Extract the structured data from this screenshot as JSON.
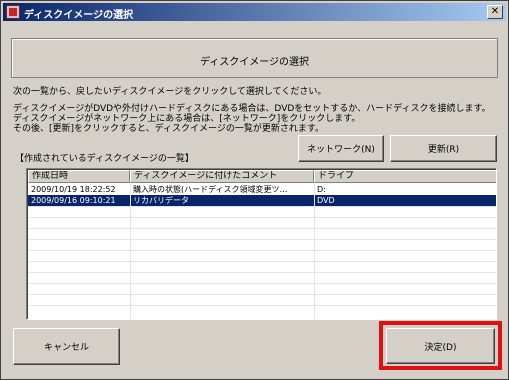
{
  "window": {
    "title": "ディスクイメージの選択",
    "close_symbol": "✕"
  },
  "header": {
    "title": "ディスクイメージの選択"
  },
  "instructions": {
    "line1": "次の一覧から、戻したいディスクイメージをクリックして選択してください。",
    "line2": "ディスクイメージがDVDや外付けハードディスクにある場合は、DVDをセットするか、ハードディスクを接続します。",
    "line3": "ディスクイメージがネットワーク上にある場合は、[ネットワーク]をクリックします。",
    "line4": "その後、[更新]をクリックすると、ディスクイメージの一覧が更新されます。"
  },
  "list_section": {
    "label": "【作成されているディスクイメージの一覧】",
    "network_button": "ネットワーク(N)",
    "refresh_button": "更新(R)"
  },
  "table": {
    "columns": [
      "作成日時",
      "ディスクイメージに付けたコメント",
      "ドライブ"
    ],
    "rows": [
      {
        "date": "2009/10/19 18:22:52",
        "comment": "購入時の状態(ハードディスク領域変更ツ…",
        "drive": "D:",
        "selected": false
      },
      {
        "date": "2009/09/16 09:10:21",
        "comment": "リカバリデータ",
        "drive": "DVD",
        "selected": true
      }
    ]
  },
  "footer": {
    "cancel_button": "キャンセル",
    "ok_button": "決定(D)"
  },
  "colors": {
    "highlight": "#e01010",
    "selection": "#0a246a",
    "titlebar_start": "#0a246a",
    "titlebar_end": "#a6caf0"
  }
}
